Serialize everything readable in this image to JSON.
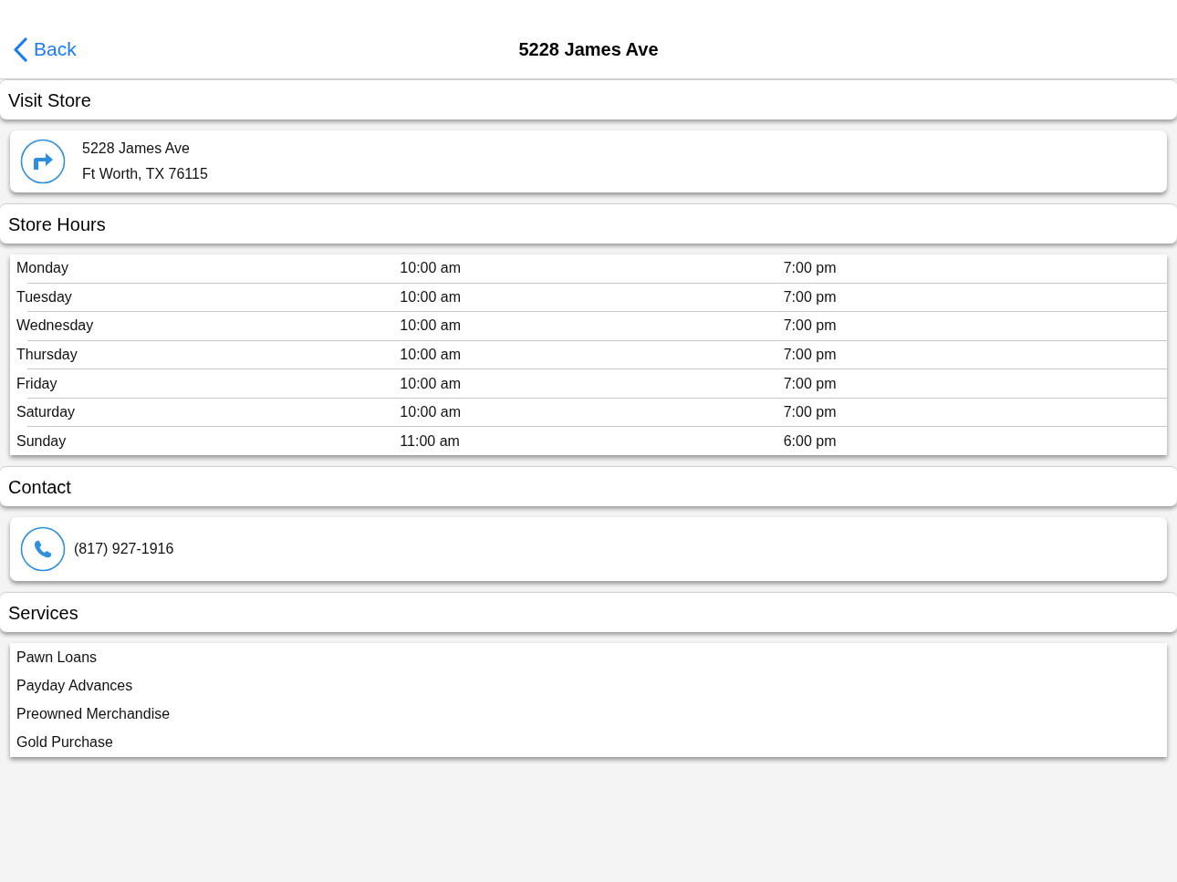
{
  "nav": {
    "back": "Back",
    "title": "5228 James Ave"
  },
  "sections": [
    {
      "kind": "address",
      "title": "Visit Store",
      "lines": [
        "5228 James Ave",
        "Ft Worth, TX 76115"
      ]
    },
    {
      "kind": "hours",
      "title": "Store Hours",
      "rows": [
        {
          "day": "Monday",
          "open": "10:00 am",
          "close": "7:00 pm"
        },
        {
          "day": "Tuesday",
          "open": "10:00 am",
          "close": "7:00 pm"
        },
        {
          "day": "Wednesday",
          "open": "10:00 am",
          "close": "7:00 pm"
        },
        {
          "day": "Thursday",
          "open": "10:00 am",
          "close": "7:00 pm"
        },
        {
          "day": "Friday",
          "open": "10:00 am",
          "close": "7:00 pm"
        },
        {
          "day": "Saturday",
          "open": "10:00 am",
          "close": "7:00 pm"
        },
        {
          "day": "Sunday",
          "open": "11:00 am",
          "close": "6:00 pm"
        }
      ]
    },
    {
      "kind": "phone",
      "title": "Contact",
      "phone": "(817) 927-1916"
    },
    {
      "kind": "list",
      "title": "Services",
      "items": [
        "Pawn Loans",
        "Payday Advances",
        "Preowned Merchandise",
        "Gold Purchase"
      ]
    }
  ]
}
